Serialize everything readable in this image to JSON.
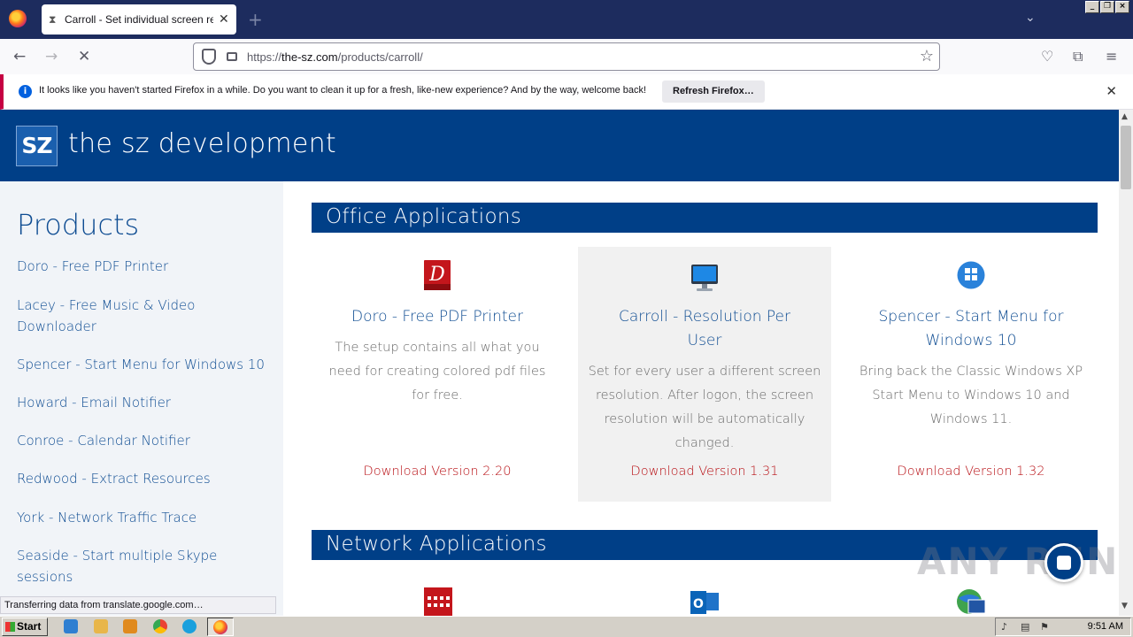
{
  "browser": {
    "tab_title": "Carroll - Set individual screen resol",
    "new_tab": "+",
    "url_prefix": "https://",
    "url_host": "the-sz.com",
    "url_path": "/products/carroll/",
    "notice_text": "It looks like you haven't started Firefox in a while. Do you want to clean it up for a fresh, like-new experience? And by the way, welcome back!",
    "notice_button": "Refresh Firefox…",
    "status_text": "Transferring data from translate.google.com…"
  },
  "site": {
    "logo_text": "SZ",
    "title": "the sz development"
  },
  "sidebar": {
    "heading": "Products",
    "items": [
      {
        "label": "Doro - Free PDF Printer"
      },
      {
        "label": "Lacey - Free Music & Video Downloader"
      },
      {
        "label": "Spencer - Start Menu for Windows 10"
      },
      {
        "label": "Howard - Email Notifier"
      },
      {
        "label": "Conroe - Calendar Notifier"
      },
      {
        "label": "Redwood - Extract Resources"
      },
      {
        "label": "York - Network Traffic Trace"
      },
      {
        "label": "Seaside - Start multiple Skype sessions"
      }
    ]
  },
  "sections": {
    "office": "Office Applications",
    "network": "Network Applications"
  },
  "cards": [
    {
      "title": "Doro - Free PDF Printer",
      "desc": "The setup contains all what you need for creating colored pdf files for free.",
      "download": "Download Version 2.20",
      "icon": "pdf-printer-icon"
    },
    {
      "title": "Carroll - Resolution Per User",
      "desc": "Set for every user a different screen resolution. After logon, the screen resolution will be automatically changed.",
      "download": "Download Version 1.31",
      "icon": "monitor-icon"
    },
    {
      "title": "Spencer - Start Menu for Windows 10",
      "desc": "Bring back the Classic Windows XP Start Menu to Windows 10 and Windows 11.",
      "download": "Download Version 1.32",
      "icon": "windows-logo-icon"
    }
  ],
  "watermark": "ANY RUN",
  "taskbar": {
    "start": "Start",
    "clock": "9:51 AM"
  },
  "colors": {
    "brand_blue": "#003f87",
    "link_blue": "#0e4c92",
    "download_red": "#b80f14"
  }
}
